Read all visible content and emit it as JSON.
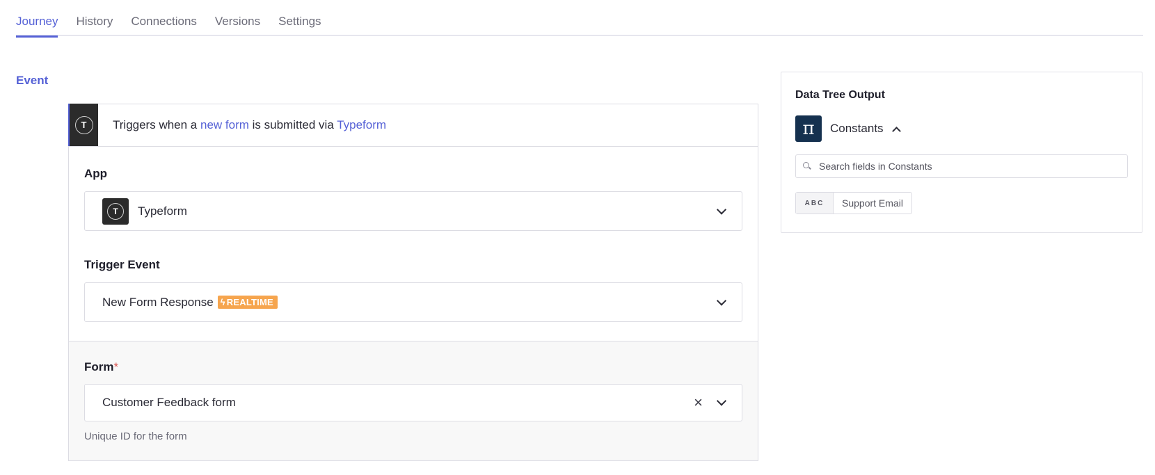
{
  "tabs": [
    "Journey",
    "History",
    "Connections",
    "Versions",
    "Settings"
  ],
  "section_label": "Event",
  "event_card": {
    "header": {
      "logo_letter": "T",
      "text_prefix": "Triggers when a ",
      "link1": "new form",
      "text_middle": " is submitted via ",
      "link2": "Typeform"
    },
    "app": {
      "label": "App",
      "value": "Typeform",
      "icon_letter": "T"
    },
    "trigger_event": {
      "label": "Trigger Event",
      "value": "New Form Response",
      "badge": "REALTIME"
    },
    "form": {
      "label": "Form",
      "required_mark": "*",
      "value": "Customer Feedback form",
      "helper": "Unique ID for the form"
    }
  },
  "data_tree": {
    "title": "Data Tree Output",
    "group": {
      "icon": "π",
      "label": "Constants"
    },
    "search_placeholder": "Search fields in Constants",
    "fields": [
      {
        "type": "ABC",
        "label": "Support Email"
      }
    ]
  }
}
